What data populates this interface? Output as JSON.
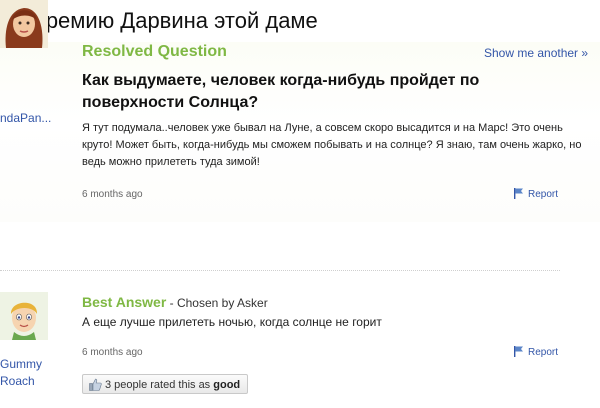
{
  "headline": "Премию Дарвина этой даме",
  "question": {
    "status": "Resolved Question",
    "show_another": "Show me another »",
    "username": "ndaPan...",
    "title": "Как выдумаете, человек когда-нибудь пройдет по поверхности Солнца?",
    "body": "Я тут подумала..человек уже бывал на Луне, а совсем скоро высадится и на Марс! Это очень круто! Может быть, когда-нибудь мы сможем побывать и на солнце? Я знаю, там очень жарко, но ведь можно прилететь туда зимой!",
    "time": "6 months ago",
    "report": "Report"
  },
  "answer": {
    "best_label": "Best Answer",
    "chosen": "- Chosen by Asker",
    "username_line1": "Gummy",
    "username_line2": "Roach",
    "text": "А еще лучше прилететь ночью, когда солнце не горит",
    "time": "6 months ago",
    "report": "Report",
    "rating_prefix": "3 people rated this as",
    "rating_value": "good"
  },
  "colors": {
    "accent_green": "#7fb844",
    "link_blue": "#3356a8"
  },
  "icons": [
    "flag-icon",
    "thumbs-up-icon"
  ]
}
